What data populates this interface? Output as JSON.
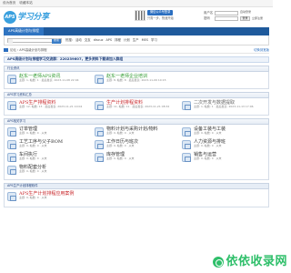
{
  "topbar": {
    "items": [
      "设为首页",
      "收藏本站"
    ]
  },
  "logo": {
    "mark": "APS",
    "word": "学习分享"
  },
  "weixin": {
    "button": "微信公众号登录",
    "sub": "只需一步，快速开始"
  },
  "login": {
    "user_label": "用户名",
    "pass_label": "密码",
    "remember": "自动登录",
    "login_button": "登录",
    "register": "立即注册"
  },
  "nav": {
    "tab": "APS高级计划与排程"
  },
  "subnav": {
    "search_button": "搜索",
    "hot": [
      "热搜:",
      "活动",
      "交友",
      "discuz",
      "APS",
      "排程",
      "计划",
      "生产",
      "MES",
      "学习"
    ]
  },
  "breadcrumb": {
    "home": "论坛",
    "path": "APS高级计划与排程",
    "right": "切换到宽版"
  },
  "notice": "APS高级计划与排程学习交流群：220239607，更多资料下载请加入群组",
  "sections": [
    {
      "title": "行业资讯",
      "forums": [
        {
          "name": "赵东一老师APS资讯",
          "color": "green",
          "meta": "主题: 1, 帖数: 1 · 最后发表: 2023-11-08 22:04"
        },
        {
          "name": "赵东一老师企业培训",
          "color": "green",
          "meta": "主题: 8, 帖数: 8 · 最后发表: 2023-11-09 10:15"
        }
      ]
    },
    {
      "title": "APS学习资料汇总",
      "forums": [
        {
          "name": "APS生产排程资料",
          "color": "red",
          "meta": "主题: 12, 帖数: 13 · 最后发表: 2023-11-21 10:04"
        },
        {
          "name": "生产计划排程资料",
          "color": "red",
          "meta": "主题: 11, 帖数: 11 · 最后发表: 2023-11-21 08:32"
        },
        {
          "name": "二次开发与数据提取",
          "color": "gray",
          "meta": "主题: 1, 帖数: 1 · 最后发表: 2023-11-13 17:06"
        }
      ]
    },
    {
      "title": "APS相关学习",
      "forums": [
        {
          "name": "订单管理",
          "color": "dark",
          "meta": "主题: 0, 帖数: 0 · 从未"
        },
        {
          "name": "物料计划与采购计划/物料",
          "color": "dark",
          "meta": "主题: 0, 帖数: 0 · 从未"
        },
        {
          "name": "设备工装与工装",
          "color": "dark",
          "meta": "主题: 0, 帖数: 0 · 从未"
        },
        {
          "name": "工艺工序与父子BOM",
          "color": "dark",
          "meta": "主题: 0, 帖数: 0 · 从未"
        },
        {
          "name": "工作日历与班次",
          "color": "dark",
          "meta": "主题: 0, 帖数: 0 · 从未"
        },
        {
          "name": "人力资源与排班",
          "color": "dark",
          "meta": "主题: 0, 帖数: 0 · 从未"
        },
        {
          "name": "车间执行",
          "color": "dark",
          "meta": "主题: 0, 帖数: 0 · 从未"
        },
        {
          "name": "库存管理",
          "color": "dark",
          "meta": "主题: 0, 帖数: 0 · 从未"
        },
        {
          "name": "销售与运营",
          "color": "dark",
          "meta": "主题: 0, 帖数: 0 · 从未"
        },
        {
          "name": "物料配套分析",
          "color": "dark",
          "meta": "主题: 0, 帖数: 0 · 从未"
        }
      ]
    }
  ],
  "bottom": {
    "title": "APS生产计划排程软件",
    "forums": [
      {
        "name": "APS生产计划排程应用案例",
        "color": "red",
        "meta": "主题: 0, 帖数: 0 · 从未"
      }
    ]
  },
  "watermark": {
    "text": "依依收录网"
  },
  "colors": {
    "nav": "#1f5a9c",
    "accent": "#2f74c1",
    "red": "#c8282c",
    "green": "#2f9a2f"
  }
}
